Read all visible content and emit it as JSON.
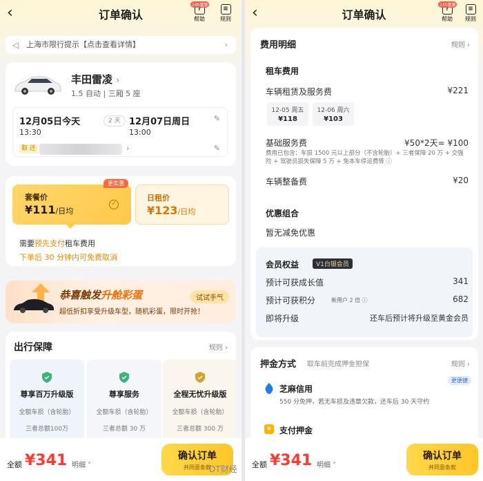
{
  "colors": {
    "accent": "#ffc629",
    "price_red": "#ff3b30",
    "orange": "#f08a00"
  },
  "left": {
    "title": "订单确认",
    "help_badge": "24h重复",
    "help_label": "帮助",
    "rules_label": "规则",
    "notice": "上海市限行提示【点击查看详情】",
    "car": {
      "name": "丰田雷凌",
      "specs": "1.5 自动 | 三厢 5 座"
    },
    "pickup": {
      "date": "12月05日今天",
      "time": "13:30",
      "tag": "取 还"
    },
    "return": {
      "date": "12月07日周日",
      "time": "13:00"
    },
    "duration": "2 天",
    "package": {
      "label": "套餐价",
      "price": "¥111",
      "unit": "/日均",
      "tag": "更实惠"
    },
    "daily": {
      "label": "日租价",
      "price": "¥123",
      "unit": "/日均"
    },
    "pay_note_pre": "需要",
    "pay_note_hl": "预先支付",
    "pay_note_post": "租车费用",
    "cancel_note": "下单后 30 分钟内可免费取消",
    "promo": {
      "title_a": "恭喜触发",
      "title_b": "升舱彩蛋",
      "subtitle": "超低折扣享受升级车型，随机彩蛋，限时开抢！",
      "button": "试试手气"
    },
    "insurance": {
      "title": "出行保障",
      "rules": "规则",
      "items": [
        {
          "name": "尊享百万升级版",
          "line1": "全额车损（含轮胎）",
          "line2": "三者总额100万"
        },
        {
          "name": "尊享服务",
          "line1": "全额车损（含轮胎）",
          "line2": "三者总额 30 万"
        },
        {
          "name": "全程无忧升级版",
          "line1": "全额车损（含轮胎）",
          "line2": "三者总额 300 万"
        }
      ]
    },
    "bottom": {
      "total_label": "全额",
      "amount": "¥341",
      "detail": "明细",
      "confirm": "确认订单",
      "agree": "并同意条款"
    }
  },
  "right": {
    "title": "订单确认",
    "help_badge": "24h重复",
    "help_label": "帮助",
    "rules_label": "规则",
    "fee_title": "费用明细",
    "fee_rules": "规则",
    "rent_title": "租车费用",
    "rent_row": {
      "label": "车辆租赁及服务费",
      "value": "¥221"
    },
    "day_prices": [
      {
        "date": "12-05 周五",
        "price": "¥118"
      },
      {
        "date": "12-06 周六",
        "price": "¥103"
      }
    ],
    "base_row": {
      "label": "基础服务费",
      "value": "¥50*2天= ¥100"
    },
    "base_note": "费用已包含：车损 1500 元以上部分（不含轮胎）+ 三者保障 20 万 + 交强险 + 驾驶员损失保障 5 万 + 免本车停运费等 ⓘ",
    "prep_row": {
      "label": "车辆整备费",
      "value": "¥20"
    },
    "discount_title": "优惠组合",
    "discount_none": "暂无减免优惠",
    "member_title": "会员权益",
    "member_badge": "V1白银会员",
    "growth_row": {
      "label": "预计可获成长值",
      "value": "341"
    },
    "points_row": {
      "label": "预计可获积分",
      "tag": "新用户 2 倍 ⓘ",
      "value": "682"
    },
    "upgrade_row": {
      "label": "即将升级",
      "value": "还车后预计将升级至黄金会员"
    },
    "deposit_title": "押金方式",
    "deposit_sub": "取车前完成押金担保",
    "deposit_rules": "规则",
    "zhima": {
      "title": "芝麻信用",
      "tag": "更便捷",
      "sub": "550 分免押，若无车损及违章欠款，还车后 30 天守约"
    },
    "pay_deposit": "支付押金",
    "bottom": {
      "total_label": "全额",
      "amount": "¥341",
      "detail": "明细",
      "confirm": "确认订单",
      "agree": "并同意条款"
    }
  },
  "watermark": "DT财经"
}
